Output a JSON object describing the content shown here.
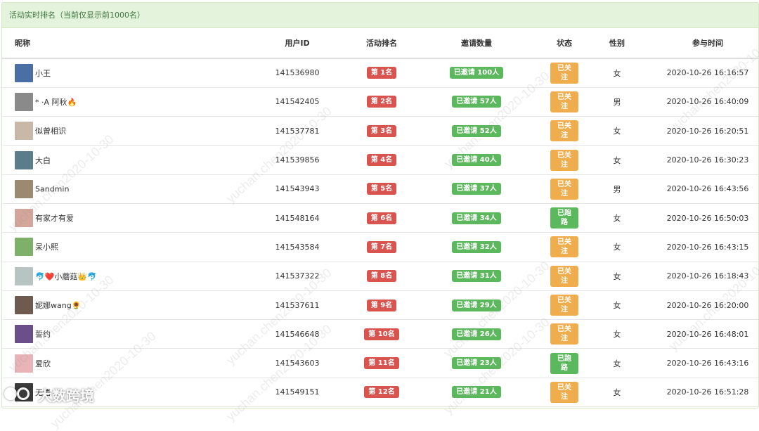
{
  "panel": {
    "title": "活动实时排名（当前仅显示前1000名）"
  },
  "columns": {
    "nickname": "昵称",
    "user_id": "用户ID",
    "rank": "活动排名",
    "invites": "邀请数量",
    "status": "状态",
    "gender": "性别",
    "join_time": "参与时间"
  },
  "rows": [
    {
      "nickname": "小王",
      "user_id": "141536980",
      "rank": "第 1名",
      "invites": "已邀请 100人",
      "status": "已关注",
      "status_type": "follow",
      "gender": "女",
      "join_time": "2020-10-26 16:16:57",
      "avatar_color": "#4a6fa5"
    },
    {
      "nickname": "* ·A 阿秋🔥",
      "user_id": "141542405",
      "rank": "第 2名",
      "invites": "已邀请 57人",
      "status": "已关注",
      "status_type": "follow",
      "gender": "男",
      "join_time": "2020-10-26 16:40:09",
      "avatar_color": "#8a8a8a"
    },
    {
      "nickname": "似曾相识",
      "user_id": "141537781",
      "rank": "第 3名",
      "invites": "已邀请 52人",
      "status": "已关注",
      "status_type": "follow",
      "gender": "女",
      "join_time": "2020-10-26 16:20:51",
      "avatar_color": "#c9b8a8"
    },
    {
      "nickname": "大白",
      "user_id": "141539856",
      "rank": "第 4名",
      "invites": "已邀请 40人",
      "status": "已关注",
      "status_type": "follow",
      "gender": "女",
      "join_time": "2020-10-26 16:30:23",
      "avatar_color": "#5b7c8a"
    },
    {
      "nickname": "Sandmin",
      "user_id": "141543943",
      "rank": "第 5名",
      "invites": "已邀请 37人",
      "status": "已关注",
      "status_type": "follow",
      "gender": "男",
      "join_time": "2020-10-26 16:43:56",
      "avatar_color": "#9c8a70"
    },
    {
      "nickname": "有家才有爱",
      "user_id": "141548164",
      "rank": "第 6名",
      "invites": "已邀请 34人",
      "status": "已跑路",
      "status_type": "run",
      "gender": "女",
      "join_time": "2020-10-26 16:50:03",
      "avatar_color": "#d4a59a"
    },
    {
      "nickname": "呆小熙",
      "user_id": "141543584",
      "rank": "第 7名",
      "invites": "已邀请 32人",
      "status": "已关注",
      "status_type": "follow",
      "gender": "女",
      "join_time": "2020-10-26 16:43:15",
      "avatar_color": "#7fb069"
    },
    {
      "nickname": "🐬❤️小蘑菇👑🐬",
      "user_id": "141537322",
      "rank": "第 8名",
      "invites": "已邀请 31人",
      "status": "已关注",
      "status_type": "follow",
      "gender": "女",
      "join_time": "2020-10-26 16:18:43",
      "avatar_color": "#b8c4c2"
    },
    {
      "nickname": "妮娜wang🌻",
      "user_id": "141537611",
      "rank": "第 9名",
      "invites": "已邀请 29人",
      "status": "已关注",
      "status_type": "follow",
      "gender": "女",
      "join_time": "2020-10-26 16:20:00",
      "avatar_color": "#6e5a4e"
    },
    {
      "nickname": "誓约",
      "user_id": "141546648",
      "rank": "第 10名",
      "invites": "已邀请 26人",
      "status": "已关注",
      "status_type": "follow",
      "gender": "女",
      "join_time": "2020-10-26 16:48:01",
      "avatar_color": "#6b4f8a"
    },
    {
      "nickname": "爱欣",
      "user_id": "141543603",
      "rank": "第 11名",
      "invites": "已邀请 23人",
      "status": "已跑路",
      "status_type": "run",
      "gender": "女",
      "join_time": "2020-10-26 16:43:16",
      "avatar_color": "#e8b4b8"
    },
    {
      "nickname": "无语",
      "user_id": "141549151",
      "rank": "第 12名",
      "invites": "已邀请 21人",
      "status": "已关注",
      "status_type": "follow",
      "gender": "女",
      "join_time": "2020-10-26 16:51:28",
      "avatar_color": "#3a3a3a"
    }
  ],
  "watermark": {
    "text": "yuchan.chen2020-10-30"
  },
  "brand": {
    "text": "大数跨境",
    "logo": "brand-logo-icon"
  }
}
